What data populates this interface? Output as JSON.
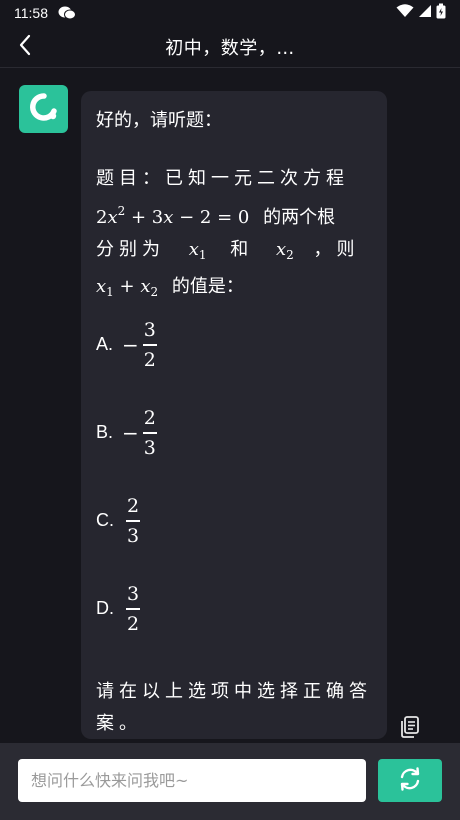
{
  "status_bar": {
    "time": "11:58",
    "icons": [
      "wechat-icon",
      "wifi-icon",
      "signal-icon",
      "battery-icon"
    ]
  },
  "header": {
    "title": "初中，数学，…",
    "back_icon": "chevron-left-icon"
  },
  "message": {
    "greeting": "好的，请听题：",
    "question_prefix": "题目：已知一元二次方程",
    "question_mid": "的两个根",
    "question_split": "分别为",
    "question_and": "和",
    "question_then": "，则",
    "question_end": "的值是：",
    "options": [
      {
        "letter": "A.",
        "sign": "−",
        "numerator": "3",
        "denominator": "2"
      },
      {
        "letter": "B.",
        "sign": "−",
        "numerator": "2",
        "denominator": "3"
      },
      {
        "letter": "C.",
        "sign": "",
        "numerator": "2",
        "denominator": "3"
      },
      {
        "letter": "D.",
        "sign": "",
        "numerator": "3",
        "denominator": "2"
      }
    ],
    "closing": "请在以上选项中选择正确答案。"
  },
  "input": {
    "placeholder": "想问什么快来问我吧~",
    "value": ""
  },
  "colors": {
    "background": "#16161c",
    "bubble": "#26262f",
    "accent": "#2bc29a",
    "bottom_bar": "#2b2b33"
  },
  "icons": {
    "avatar": "assistant-logo-icon",
    "copy": "copy-icon",
    "send": "refresh-icon"
  }
}
